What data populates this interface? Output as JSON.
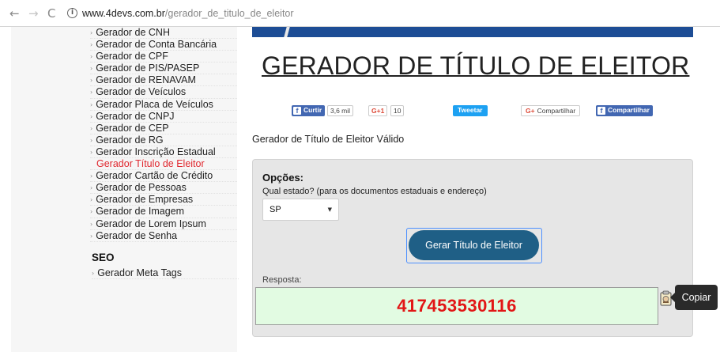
{
  "browser": {
    "back_glyph": "←",
    "forward_glyph": "→",
    "reload_glyph": "C",
    "info_glyph": "i",
    "url_host": "www.4devs.com.br",
    "url_path": "/gerador_de_titulo_de_eleitor"
  },
  "sidebar": {
    "bullet": "›",
    "items": [
      "Gerador de CNH",
      "Gerador de Conta Bancária",
      "Gerador de CPF",
      "Gerador de PIS/PASEP",
      "Gerador de RENAVAM",
      "Gerador de Veículos",
      "Gerador Placa de Veículos",
      "Gerador de CNPJ",
      "Gerador de CEP",
      "Gerador de RG",
      "Gerador Inscrição Estadual",
      "Gerador Título de Eleitor",
      "Gerador Cartão de Crédito",
      "Gerador de Pessoas",
      "Gerador de Empresas",
      "Gerador de Imagem",
      "Gerador de Lorem Ipsum",
      "Gerador de Senha"
    ],
    "active_item": "Gerador Título de Eleitor",
    "seo_heading": "SEO",
    "seo_item": "Gerador Meta Tags"
  },
  "main": {
    "title": "GERADOR DE TÍTULO DE ELEITOR",
    "subtitle": "Gerador de Título de Eleitor Válido"
  },
  "social": {
    "fb_like_label": "Curtir",
    "fb_like_count": "3,6 mil",
    "gplus_label": "G+1",
    "gplus_count": "10",
    "tweet_label": "Tweetar",
    "gshare_label": "Compartilhar",
    "gshare_prefix": "G+",
    "fb_share_label": "Compartilhar",
    "fb_glyph": "f"
  },
  "options": {
    "heading": "Opções:",
    "question": "Qual estado? (para os documentos estaduais e endereço)",
    "state_value": "SP",
    "caret": "▼",
    "generate_button": "Gerar Título de Eleitor",
    "response_label": "Resposta:",
    "response_value": "417453530116",
    "copy_tooltip": "Copiar"
  },
  "colors": {
    "accent": "#1d4d95",
    "active_link": "#e0282f",
    "result_text": "#e21616",
    "button": "#1f5f86"
  }
}
